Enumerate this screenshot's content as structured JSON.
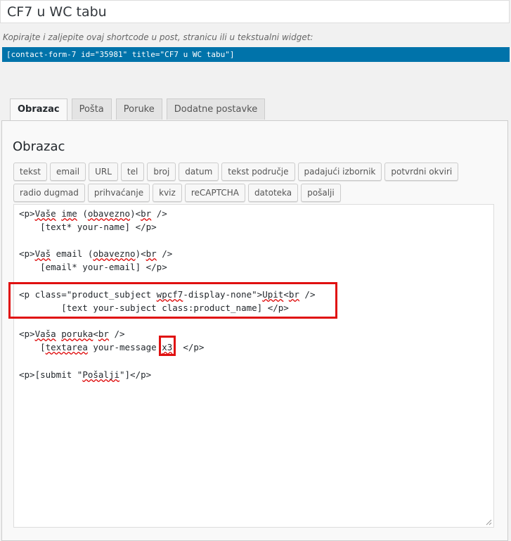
{
  "title": "CF7 u WC tabu",
  "shortcode": {
    "label": "Kopirajte i zaljepite ovaj shortcode u post, stranicu ili u tekstualni widget:",
    "value": "[contact-form-7 id=\"35981\" title=\"CF7 u WC tabu\"]"
  },
  "tabs": [
    "Obrazac",
    "Pošta",
    "Poruke",
    "Dodatne postavke"
  ],
  "panel": {
    "title": "Obrazac",
    "tag_row1": [
      "tekst",
      "email",
      "URL",
      "tel",
      "broj",
      "datum",
      "tekst područje",
      "padajući izbornik",
      "potvrdni okviri"
    ],
    "tag_row2": [
      "radio dugmad",
      "prihvaćanje",
      "kviz",
      "reCAPTCHA",
      "datoteka",
      "pošalji"
    ]
  },
  "code": {
    "l1_pre": "<p>",
    "l1_w1": "Vaše",
    "l1_s1": " ",
    "l1_w2": "ime",
    "l1_s2": " (",
    "l1_w3": "obavezno",
    "l1_s3": ")<",
    "l1_w4": "br",
    "l1_s4": " />",
    "l2": "    [text* your-name] </p>",
    "l4_pre": "<p>",
    "l4_w1": "Vaš",
    "l4_s1": " email (",
    "l4_w2": "obavezno",
    "l4_s2": ")<",
    "l4_w3": "br",
    "l4_s3": " />",
    "l5": "    [email* your-email] </p>",
    "l7_pre": "<p class=\"product_subject ",
    "l7_w1": "wpcf7",
    "l7_s1": "-display-none\">",
    "l7_w2": "Upit",
    "l7_s2": "<",
    "l7_w3": "br",
    "l7_s3": " />",
    "l8": "        [text your-subject class:product_name] </p>",
    "l10_pre": "<p>",
    "l10_w1": "Vaša",
    "l10_s1": " ",
    "l10_w2": "poruka",
    "l10_s2": "<",
    "l10_w3": "br",
    "l10_s3": " />",
    "l11_pre": "    [",
    "l11_w1": "textarea",
    "l11_s1": " your-message ",
    "l11_w2": "x3",
    "l11_s2": "] </p>",
    "l13_pre": "<p>[submit \"",
    "l13_w1": "Pošalji",
    "l13_s1": "\"]</p>"
  },
  "colors": {
    "accent": "#0073aa",
    "highlight": "#e01010"
  }
}
